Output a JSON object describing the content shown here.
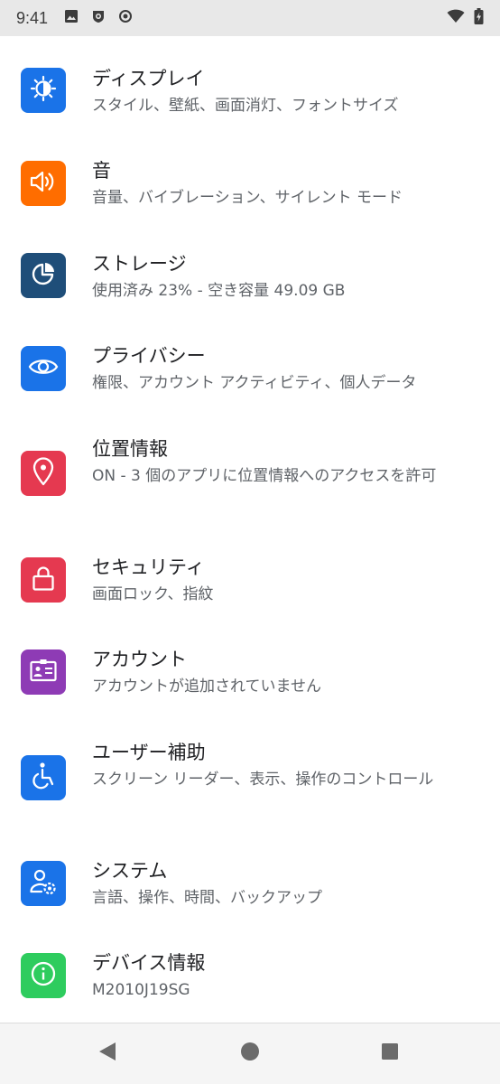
{
  "status_bar": {
    "time": "9:41",
    "left_icons": [
      "image-icon",
      "shield-app-icon",
      "record-icon"
    ],
    "right_icons": [
      "wifi-icon",
      "battery-charging-icon"
    ]
  },
  "settings": [
    {
      "icon": "display-brightness-icon",
      "color": "#1a73e8",
      "title": "ディスプレイ",
      "subtitle": "スタイル、壁紙、画面消灯、フォントサイズ"
    },
    {
      "icon": "volume-icon",
      "color": "#ff6d00",
      "title": "音",
      "subtitle": "音量、バイブレーション、サイレント モード"
    },
    {
      "icon": "storage-pie-icon",
      "color": "#1f4e79",
      "title": "ストレージ",
      "subtitle": "使用済み 23% - 空き容量 49.09 GB"
    },
    {
      "icon": "privacy-eye-icon",
      "color": "#1a73e8",
      "title": "プライバシー",
      "subtitle": "権限、アカウント アクティビティ、個人データ"
    },
    {
      "icon": "location-pin-icon",
      "color": "#e53950",
      "title": "位置情報",
      "subtitle": "ON - 3 個のアプリに位置情報へのアクセスを許可"
    },
    {
      "icon": "lock-icon",
      "color": "#e53950",
      "title": "セキュリティ",
      "subtitle": "画面ロック、指紋"
    },
    {
      "icon": "account-card-icon",
      "color": "#8e3bb5",
      "title": "アカウント",
      "subtitle": "アカウントが追加されていません"
    },
    {
      "icon": "accessibility-icon",
      "color": "#1a73e8",
      "title": "ユーザー補助",
      "subtitle": "スクリーン リーダー、表示、操作のコントロール"
    },
    {
      "icon": "system-user-gear-icon",
      "color": "#1a73e8",
      "title": "システム",
      "subtitle": "言語、操作、時間、バックアップ"
    },
    {
      "icon": "info-icon",
      "color": "#2ecc5e",
      "title": "デバイス情報",
      "subtitle": "M2010J19SG"
    }
  ],
  "nav_bar": {
    "buttons": [
      "back-icon",
      "home-icon",
      "recents-icon"
    ]
  }
}
